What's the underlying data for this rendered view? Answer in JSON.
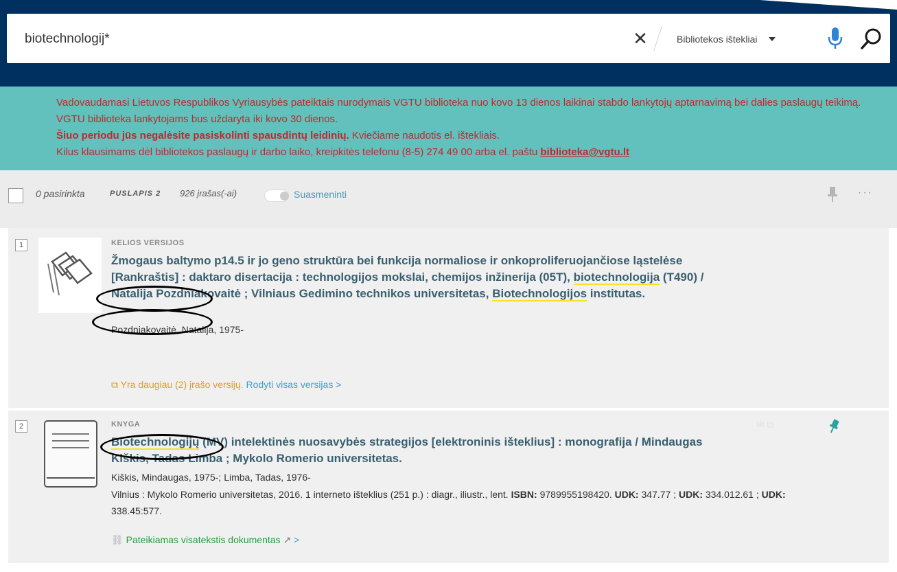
{
  "search": {
    "query": "biotechnologij*",
    "scope": "Bibliotekos ištekliai"
  },
  "announcement": {
    "line1": "Vadovaudamasi Lietuvos Respublikos Vyriausybės pateiktais nurodymais VGTU biblioteka nuo kovo 13 dienos laikinai stabdo lankytojų aptarnavimą bei dalies paslaugų teikimą. VGTU biblioteka lankytojams bus uždaryta iki kovo 30 dienos.",
    "bold_line": "Šiuo periodu jūs negalėsite pasiskolinti spausdintų leidinių.",
    "after_bold": " Kviečiame naudotis el. ištekliais.",
    "contact_prefix": "Kilus klausimams dėl bibliotekos paslaugų ir darbo laiko, kreipkitės telefonu (8-5) 274 49 00 arba el. paštu ",
    "email": "biblioteka@vgtu.lt"
  },
  "toolbar": {
    "selected": "0 pasirinkta",
    "page": "PUSLAPIS 2",
    "count": "926 įrašas(-ai)",
    "personalize": "Suasmeninti",
    "more": "···"
  },
  "results": [
    {
      "rank": "1",
      "type": "KELIOS VERSIJOS",
      "title_a": "Žmogaus baltymo p14.5 ir jo geno struktūra bei funkcija normaliose ir onkoproliferuojančiose ląstelėse [Rankraštis] : daktaro disertacija : technologijos mokslai, chemijos inžinerija (05T), ",
      "title_hl1": "biotechnologija",
      "title_b": " (T490) / Natalija Pozdniakovaitė ; Vilniaus Gedimino technikos universitetas, ",
      "title_hl2": "Biotechnologijos",
      "title_c": " institutas.",
      "author": "Pozdniakovaitė, Natalija, 1975-",
      "versions_text": "Yra daugiau (2) įrašo versijų.",
      "versions_link": "Rodyti visas versijas",
      "chevron": ">"
    },
    {
      "rank": "2",
      "type": "KNYGA",
      "title_hl": "Biotechnologijų",
      "title_rest": " (MV) intelektinės nuosavybės strategijos [elektroninis išteklius] : monografija / Mindaugas Kiškis, Tadas Limba ; Mykolo Romerio universitetas.",
      "author": "Kiškis, Mindaugas, 1975-; Limba, Tadas, 1976-",
      "details_pre": "Vilnius : Mykolo Romerio universitetas, 2016. 1 interneto išteklius (251 p.) : diagr., iliustr., lent. ",
      "isbn_label": "ISBN:",
      "isbn": " 9789955198420. ",
      "udk_label": "UDK:",
      "udk1": " 347.77 ; ",
      "udk2": " 334.012.61 ; ",
      "udk3": " 338.45:577.",
      "fulltext": "Pateikiamas visatekstis dokumentas",
      "chevron": ">"
    }
  ],
  "colors": {
    "topbar": "#00305f",
    "announce_bg": "#62c1bd",
    "announce_text": "#c2272d",
    "title": "#3a5f6f",
    "highlight": "#f5e02a",
    "versions": "#e39a1f",
    "link": "#3b9fd3",
    "fulltext": "#2a9a3a"
  }
}
